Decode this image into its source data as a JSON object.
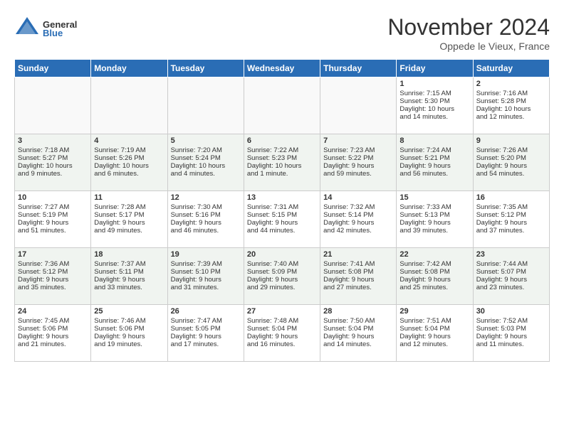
{
  "header": {
    "logo_general": "General",
    "logo_blue": "Blue",
    "month_title": "November 2024",
    "subtitle": "Oppede le Vieux, France"
  },
  "weekdays": [
    "Sunday",
    "Monday",
    "Tuesday",
    "Wednesday",
    "Thursday",
    "Friday",
    "Saturday"
  ],
  "weeks": [
    {
      "days": [
        {
          "num": "",
          "empty": true,
          "lines": []
        },
        {
          "num": "",
          "empty": true,
          "lines": []
        },
        {
          "num": "",
          "empty": true,
          "lines": []
        },
        {
          "num": "",
          "empty": true,
          "lines": []
        },
        {
          "num": "",
          "empty": true,
          "lines": []
        },
        {
          "num": "1",
          "empty": false,
          "lines": [
            "Sunrise: 7:15 AM",
            "Sunset: 5:30 PM",
            "Daylight: 10 hours",
            "and 14 minutes."
          ]
        },
        {
          "num": "2",
          "empty": false,
          "lines": [
            "Sunrise: 7:16 AM",
            "Sunset: 5:28 PM",
            "Daylight: 10 hours",
            "and 12 minutes."
          ]
        }
      ]
    },
    {
      "days": [
        {
          "num": "3",
          "empty": false,
          "lines": [
            "Sunrise: 7:18 AM",
            "Sunset: 5:27 PM",
            "Daylight: 10 hours",
            "and 9 minutes."
          ]
        },
        {
          "num": "4",
          "empty": false,
          "lines": [
            "Sunrise: 7:19 AM",
            "Sunset: 5:26 PM",
            "Daylight: 10 hours",
            "and 6 minutes."
          ]
        },
        {
          "num": "5",
          "empty": false,
          "lines": [
            "Sunrise: 7:20 AM",
            "Sunset: 5:24 PM",
            "Daylight: 10 hours",
            "and 4 minutes."
          ]
        },
        {
          "num": "6",
          "empty": false,
          "lines": [
            "Sunrise: 7:22 AM",
            "Sunset: 5:23 PM",
            "Daylight: 10 hours",
            "and 1 minute."
          ]
        },
        {
          "num": "7",
          "empty": false,
          "lines": [
            "Sunrise: 7:23 AM",
            "Sunset: 5:22 PM",
            "Daylight: 9 hours",
            "and 59 minutes."
          ]
        },
        {
          "num": "8",
          "empty": false,
          "lines": [
            "Sunrise: 7:24 AM",
            "Sunset: 5:21 PM",
            "Daylight: 9 hours",
            "and 56 minutes."
          ]
        },
        {
          "num": "9",
          "empty": false,
          "lines": [
            "Sunrise: 7:26 AM",
            "Sunset: 5:20 PM",
            "Daylight: 9 hours",
            "and 54 minutes."
          ]
        }
      ]
    },
    {
      "days": [
        {
          "num": "10",
          "empty": false,
          "lines": [
            "Sunrise: 7:27 AM",
            "Sunset: 5:19 PM",
            "Daylight: 9 hours",
            "and 51 minutes."
          ]
        },
        {
          "num": "11",
          "empty": false,
          "lines": [
            "Sunrise: 7:28 AM",
            "Sunset: 5:17 PM",
            "Daylight: 9 hours",
            "and 49 minutes."
          ]
        },
        {
          "num": "12",
          "empty": false,
          "lines": [
            "Sunrise: 7:30 AM",
            "Sunset: 5:16 PM",
            "Daylight: 9 hours",
            "and 46 minutes."
          ]
        },
        {
          "num": "13",
          "empty": false,
          "lines": [
            "Sunrise: 7:31 AM",
            "Sunset: 5:15 PM",
            "Daylight: 9 hours",
            "and 44 minutes."
          ]
        },
        {
          "num": "14",
          "empty": false,
          "lines": [
            "Sunrise: 7:32 AM",
            "Sunset: 5:14 PM",
            "Daylight: 9 hours",
            "and 42 minutes."
          ]
        },
        {
          "num": "15",
          "empty": false,
          "lines": [
            "Sunrise: 7:33 AM",
            "Sunset: 5:13 PM",
            "Daylight: 9 hours",
            "and 39 minutes."
          ]
        },
        {
          "num": "16",
          "empty": false,
          "lines": [
            "Sunrise: 7:35 AM",
            "Sunset: 5:12 PM",
            "Daylight: 9 hours",
            "and 37 minutes."
          ]
        }
      ]
    },
    {
      "days": [
        {
          "num": "17",
          "empty": false,
          "lines": [
            "Sunrise: 7:36 AM",
            "Sunset: 5:12 PM",
            "Daylight: 9 hours",
            "and 35 minutes."
          ]
        },
        {
          "num": "18",
          "empty": false,
          "lines": [
            "Sunrise: 7:37 AM",
            "Sunset: 5:11 PM",
            "Daylight: 9 hours",
            "and 33 minutes."
          ]
        },
        {
          "num": "19",
          "empty": false,
          "lines": [
            "Sunrise: 7:39 AM",
            "Sunset: 5:10 PM",
            "Daylight: 9 hours",
            "and 31 minutes."
          ]
        },
        {
          "num": "20",
          "empty": false,
          "lines": [
            "Sunrise: 7:40 AM",
            "Sunset: 5:09 PM",
            "Daylight: 9 hours",
            "and 29 minutes."
          ]
        },
        {
          "num": "21",
          "empty": false,
          "lines": [
            "Sunrise: 7:41 AM",
            "Sunset: 5:08 PM",
            "Daylight: 9 hours",
            "and 27 minutes."
          ]
        },
        {
          "num": "22",
          "empty": false,
          "lines": [
            "Sunrise: 7:42 AM",
            "Sunset: 5:08 PM",
            "Daylight: 9 hours",
            "and 25 minutes."
          ]
        },
        {
          "num": "23",
          "empty": false,
          "lines": [
            "Sunrise: 7:44 AM",
            "Sunset: 5:07 PM",
            "Daylight: 9 hours",
            "and 23 minutes."
          ]
        }
      ]
    },
    {
      "days": [
        {
          "num": "24",
          "empty": false,
          "lines": [
            "Sunrise: 7:45 AM",
            "Sunset: 5:06 PM",
            "Daylight: 9 hours",
            "and 21 minutes."
          ]
        },
        {
          "num": "25",
          "empty": false,
          "lines": [
            "Sunrise: 7:46 AM",
            "Sunset: 5:06 PM",
            "Daylight: 9 hours",
            "and 19 minutes."
          ]
        },
        {
          "num": "26",
          "empty": false,
          "lines": [
            "Sunrise: 7:47 AM",
            "Sunset: 5:05 PM",
            "Daylight: 9 hours",
            "and 17 minutes."
          ]
        },
        {
          "num": "27",
          "empty": false,
          "lines": [
            "Sunrise: 7:48 AM",
            "Sunset: 5:04 PM",
            "Daylight: 9 hours",
            "and 16 minutes."
          ]
        },
        {
          "num": "28",
          "empty": false,
          "lines": [
            "Sunrise: 7:50 AM",
            "Sunset: 5:04 PM",
            "Daylight: 9 hours",
            "and 14 minutes."
          ]
        },
        {
          "num": "29",
          "empty": false,
          "lines": [
            "Sunrise: 7:51 AM",
            "Sunset: 5:04 PM",
            "Daylight: 9 hours",
            "and 12 minutes."
          ]
        },
        {
          "num": "30",
          "empty": false,
          "lines": [
            "Sunrise: 7:52 AM",
            "Sunset: 5:03 PM",
            "Daylight: 9 hours",
            "and 11 minutes."
          ]
        }
      ]
    }
  ]
}
